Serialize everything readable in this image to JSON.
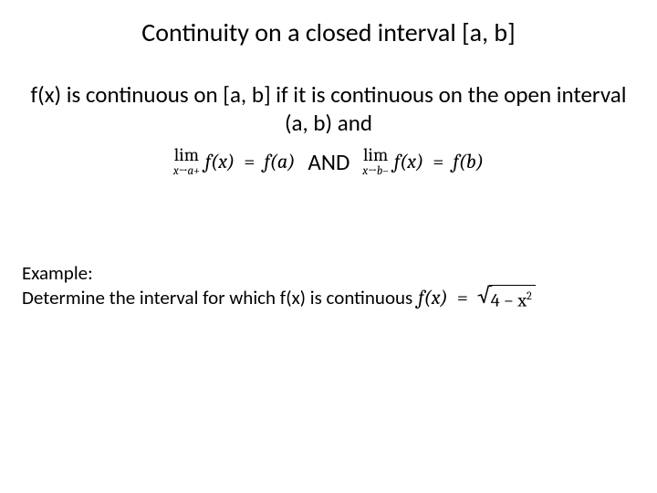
{
  "title": "Continuity on a closed interval [a, b]",
  "definition": "f(x) is continuous on [a, b] if it is continuous on the open interval (a, b) and",
  "limit_left": {
    "lim": "lim",
    "sub": "x→a+",
    "expr_lhs": "f(x)",
    "eq": "=",
    "expr_rhs": "f(a)"
  },
  "and_text": "AND",
  "limit_right": {
    "lim": "lim",
    "sub": "x→b−",
    "expr_lhs": "f(x)",
    "eq": "=",
    "expr_rhs": "f(b)"
  },
  "example": {
    "label": "Example:",
    "prompt": "Determine the interval for which f(x) is continuous",
    "func_lhs": "f(x)",
    "eq": "=",
    "radicand_pre": "4 − x",
    "radicand_exp": "2"
  }
}
